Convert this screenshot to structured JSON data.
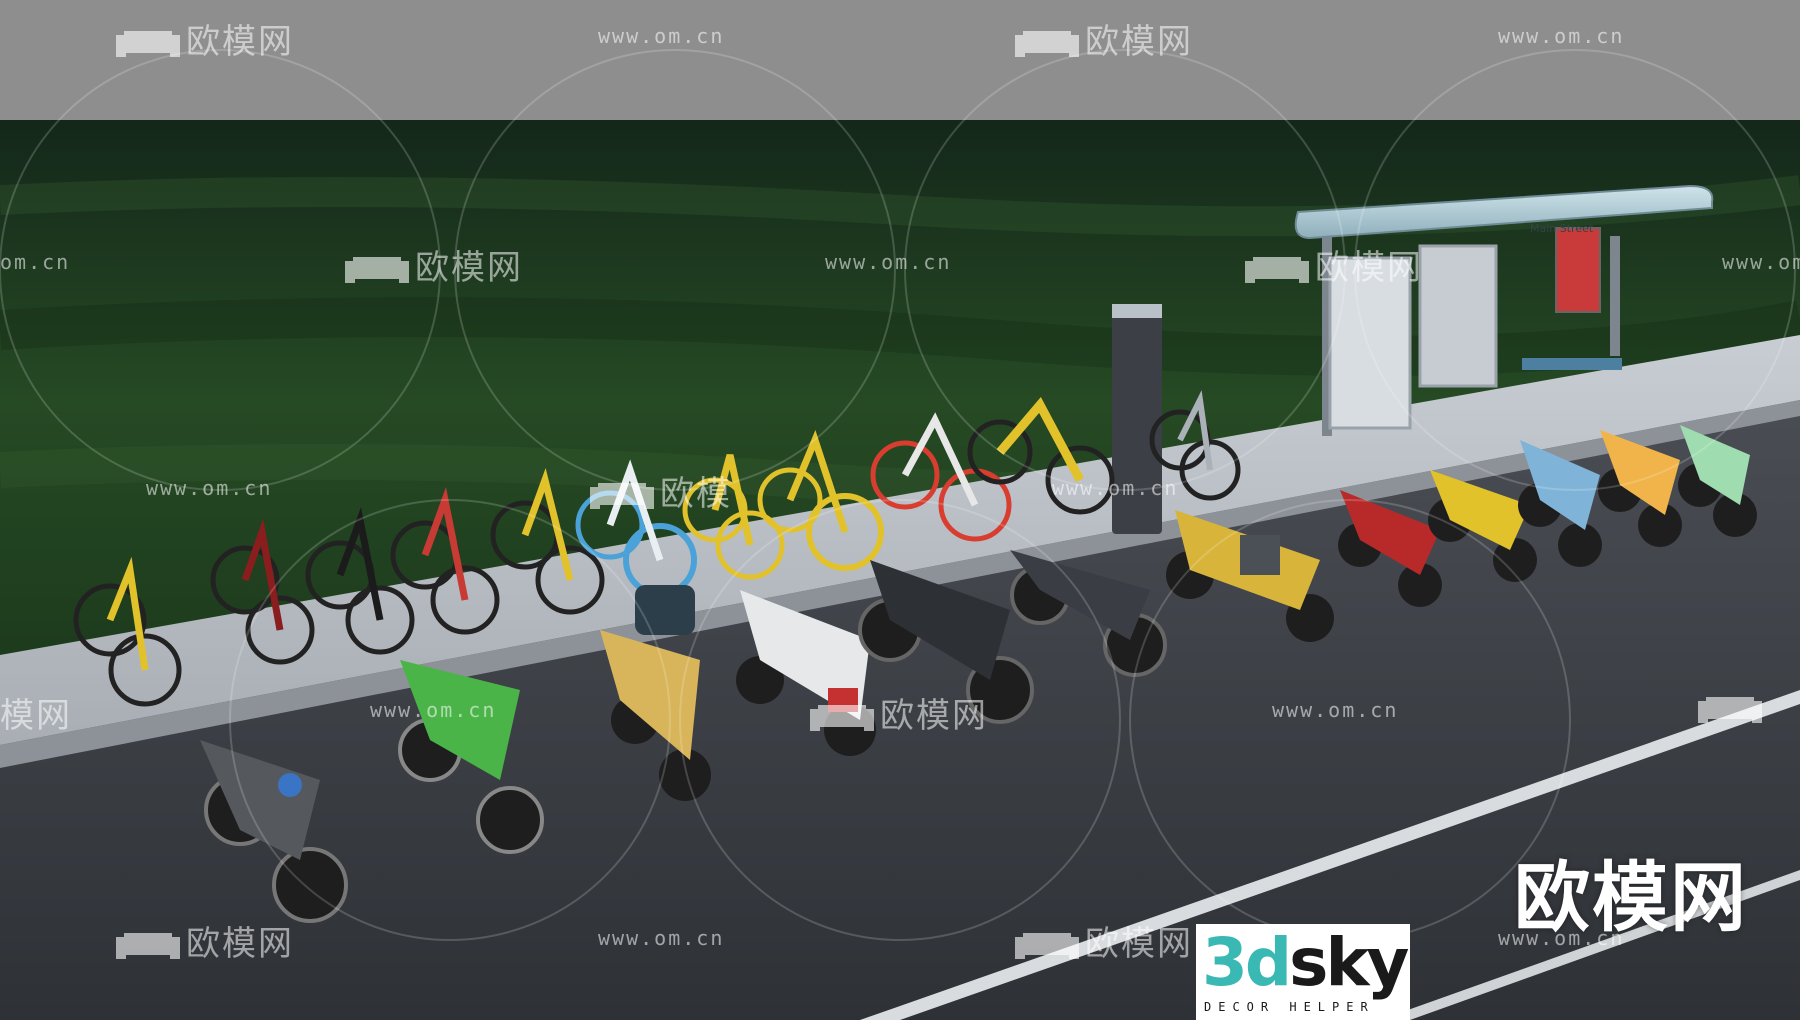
{
  "watermark": {
    "cn_text": "欧模网",
    "url_text": "www.om.cn",
    "url_fragment": "om.cn",
    "cn_fragment": "模网",
    "cn_partial": "欧模"
  },
  "brand": {
    "cn_name": "欧模网",
    "logo_3d": "3d",
    "logo_sky": "sky",
    "logo_tagline": "DECOR HELPER"
  },
  "bus_stop": {
    "sign_text": "Main Street"
  },
  "scene": {
    "subject": "vehicles-collection",
    "colors": {
      "sky": "#8e8e8e",
      "grass": "#1f3a1e",
      "sidewalk": "#b8bec4",
      "road": "#3a3d42",
      "accent_yellow": "#e2c22b",
      "accent_teal": "#3ab8b4"
    }
  }
}
